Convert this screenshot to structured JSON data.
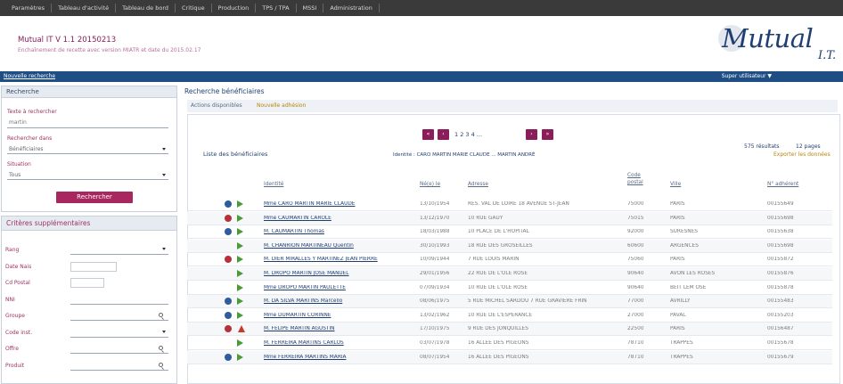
{
  "topnav": {
    "items": [
      "Paramètres",
      "Tableau d'activité",
      "Tableau de bord",
      "Critique",
      "Production",
      "TPS / TPA",
      "MSSI",
      "Administration"
    ]
  },
  "header": {
    "app_title": "Mutual IT V 1.1 20150213",
    "app_subtitle": "Enchaînement de recette avec version MIATR et date du 2015.02.17",
    "logo_main": "Mutual",
    "logo_sub": "I.T."
  },
  "subbar": {
    "new_search": "Nouvelle recherche",
    "user_menu": "Super utilisateur  ▼"
  },
  "search_panel": {
    "title": "Recherche",
    "text_label": "Texte à rechercher",
    "text_value": "martin",
    "in_label": "Rechercher dans",
    "in_value": "Bénéficiaires",
    "situation_label": "Situation",
    "situation_value": "Tous",
    "search_button": "Rechercher"
  },
  "criteria_panel": {
    "title": "Critères supplémentaires",
    "fields": [
      "Rang",
      "Date Nais",
      "Cd Postal",
      "NNI",
      "Groupe",
      "Code inst.",
      "Offre",
      "Produit"
    ]
  },
  "main": {
    "title": "Recherche bénéficiaires",
    "tab_actions": "Actions disponibles",
    "tab_new": "Nouvelle adhésion",
    "list_title": "Liste des bénéficiaires",
    "pager_nums": "1 2 3 4 ... ",
    "identity_prefix": "Identité :",
    "identity_value": "CARO MARTIN MARIE CLAUDE ... MARTIN ANDRÉ",
    "results": "575 résultats",
    "pages": "12 pages",
    "export": "Exporter les données"
  },
  "pager": {
    "first": "«",
    "prev": "‹",
    "next": "›",
    "last": "»"
  },
  "table": {
    "headers": [
      "Identité",
      "Né(e) le",
      "Adresse",
      "Code postal",
      "Ville",
      "N° adhérent"
    ],
    "rows": [
      {
        "icons": [
          "blue",
          "green"
        ],
        "name": "Mme CARO MARTIN MARIE CLAUDE",
        "birth": "13/10/1954",
        "address": "RES. VAL DE LOIRE 18 AVENUE ST-JEAN",
        "cp": "75000",
        "city": "PARIS",
        "num": "00155649"
      },
      {
        "icons": [
          "red",
          "green"
        ],
        "name": "Mme CAUMARTIN CAROLE",
        "birth": "13/12/1970",
        "address": "10 RUE GAUY",
        "cp": "75015",
        "city": "PARIS",
        "num": "00155698"
      },
      {
        "icons": [
          "blue",
          "green"
        ],
        "name": "M. CAUMARTIN Thomas",
        "birth": "18/03/1988",
        "address": "10 PLACE DE L'HOPITAL",
        "cp": "92000",
        "city": "SURESNES",
        "num": "00155638"
      },
      {
        "icons": [
          "",
          "green"
        ],
        "name": "M. CHANRION MARTINEAU Quentin",
        "birth": "30/10/1993",
        "address": "18 RUE DES GROSEILLES",
        "cp": "60600",
        "city": "ARGENCES",
        "num": "00155698"
      },
      {
        "icons": [
          "red",
          "green"
        ],
        "name": "M. DIER MIRALLES Y MARTINEZ JEAN PIERRE",
        "birth": "10/09/1944",
        "address": "7 RUE LOUIS MARIN",
        "cp": "75060",
        "city": "PARIS",
        "num": "00155872"
      },
      {
        "icons": [
          "",
          "green"
        ],
        "name": "M. DROPO MARTIN JOSE MANUEL",
        "birth": "29/01/1956",
        "address": "22 RUE DE L'OLE ROSE",
        "cp": "90640",
        "city": "AVON LES ROSES",
        "num": "00155876"
      },
      {
        "icons": [
          "",
          "green"
        ],
        "name": "Mme DROPO MARTIN PAULETTE",
        "birth": "07/09/1934",
        "address": "10 RUE DE L'OLE ROSE",
        "cp": "90640",
        "city": "BEIT LEM OSE",
        "num": "00155878"
      },
      {
        "icons": [
          "blue",
          "green"
        ],
        "name": "M. DA SILVA MARTINS Marcello",
        "birth": "08/06/1975",
        "address": "5 RUE MICHEL SARDOU 7 RUE GRAVIERE FRIN",
        "cp": "77000",
        "city": "AVRILLY",
        "num": "00155483"
      },
      {
        "icons": [
          "blue",
          "green"
        ],
        "name": "Mme DUMARTIN CORINNE",
        "birth": "13/02/1962",
        "address": "10 RUE DE L'ESPERANCE",
        "cp": "27000",
        "city": "PAVAL",
        "num": "00155203"
      },
      {
        "icons": [
          "red",
          "tri"
        ],
        "name": "M. FELIPE MARTIN AGUSTIN",
        "birth": "17/10/1975",
        "address": "9 RUE DES JONQUILLES",
        "cp": "22500",
        "city": "PARIS",
        "num": "00156487"
      },
      {
        "icons": [
          "",
          "green"
        ],
        "name": "M. FERREIRA MARTINS CARLOS",
        "birth": "03/07/1978",
        "address": "16 ALLEE DES PIGEONS",
        "cp": "78710",
        "city": "TRAPPES",
        "num": "00155678"
      },
      {
        "icons": [
          "blue",
          "green"
        ],
        "name": "Mme FERREIRA MARTINS MARIA",
        "birth": "08/07/1954",
        "address": "16 ALLEE DES PIGEONS",
        "cp": "78710",
        "city": "TRAPPES",
        "num": "00155679"
      }
    ]
  },
  "colors": {
    "accent": "#8a1d5a",
    "brand_blue": "#1f4e84",
    "green_icon": "#4a9a3a",
    "red_icon": "#b5323a"
  }
}
